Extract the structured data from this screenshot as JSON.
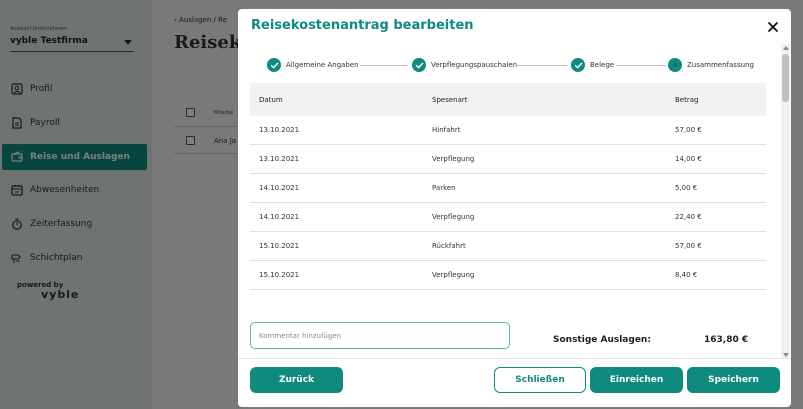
{
  "background": {
    "sidebar": {
      "company_label": "Auswahl Unternehmen",
      "company_value": "vyble Testfirma",
      "items": [
        {
          "label": "Profil",
          "icon": "profile-icon"
        },
        {
          "label": "Payroll",
          "icon": "payroll-icon"
        },
        {
          "label": "Reise und Auslagen",
          "icon": "wallet-icon",
          "active": true
        },
        {
          "label": "Abwesenheiten",
          "icon": "calendar-icon"
        },
        {
          "label": "Zeiterfassung",
          "icon": "stopwatch-icon"
        },
        {
          "label": "Schichtplan",
          "icon": "shift-plan-icon"
        }
      ],
      "powered_by": "powered by",
      "brand": "vyble"
    },
    "breadcrumb": "‹  Auslagen  /  Re",
    "page_title": "Reiseko",
    "table_header_first": "Mitarbe",
    "row_name": "Ana Ja"
  },
  "modal": {
    "title": "Reisekostenantrag bearbeiten",
    "steps": [
      {
        "label": "Allgemeine Angaben",
        "state": "done"
      },
      {
        "label": "Verpflegungspauschalen",
        "state": "done"
      },
      {
        "label": "Belege",
        "state": "done"
      },
      {
        "label": "Zusammenfassung",
        "state": "current",
        "number": "4"
      }
    ],
    "table": {
      "headers": [
        "Datum",
        "Spesenart",
        "Betrag"
      ],
      "rows": [
        [
          "13.10.2021",
          "Hinfahrt",
          "57,00 €"
        ],
        [
          "13.10.2021",
          "Verpflegung",
          "14,00 €"
        ],
        [
          "14.10.2021",
          "Parken",
          "5,00 €"
        ],
        [
          "14.10.2021",
          "Verpflegung",
          "22,40 €"
        ],
        [
          "15.10.2021",
          "Rückfahrt",
          "57,00 €"
        ],
        [
          "15.10.2021",
          "Verpflegung",
          "8,40 €"
        ]
      ]
    },
    "comment_placeholder": "Kommentar hinzufügen",
    "summary_label": "Sonstige Auslagen:",
    "summary_value": "163,80 €",
    "buttons": {
      "back": "Zurück",
      "close": "Schließen",
      "submit": "Einreichen",
      "save": "Speichern"
    }
  },
  "colors": {
    "accent": "#0f8a7e",
    "overlay": "rgba(0,0,0,0.5)"
  }
}
